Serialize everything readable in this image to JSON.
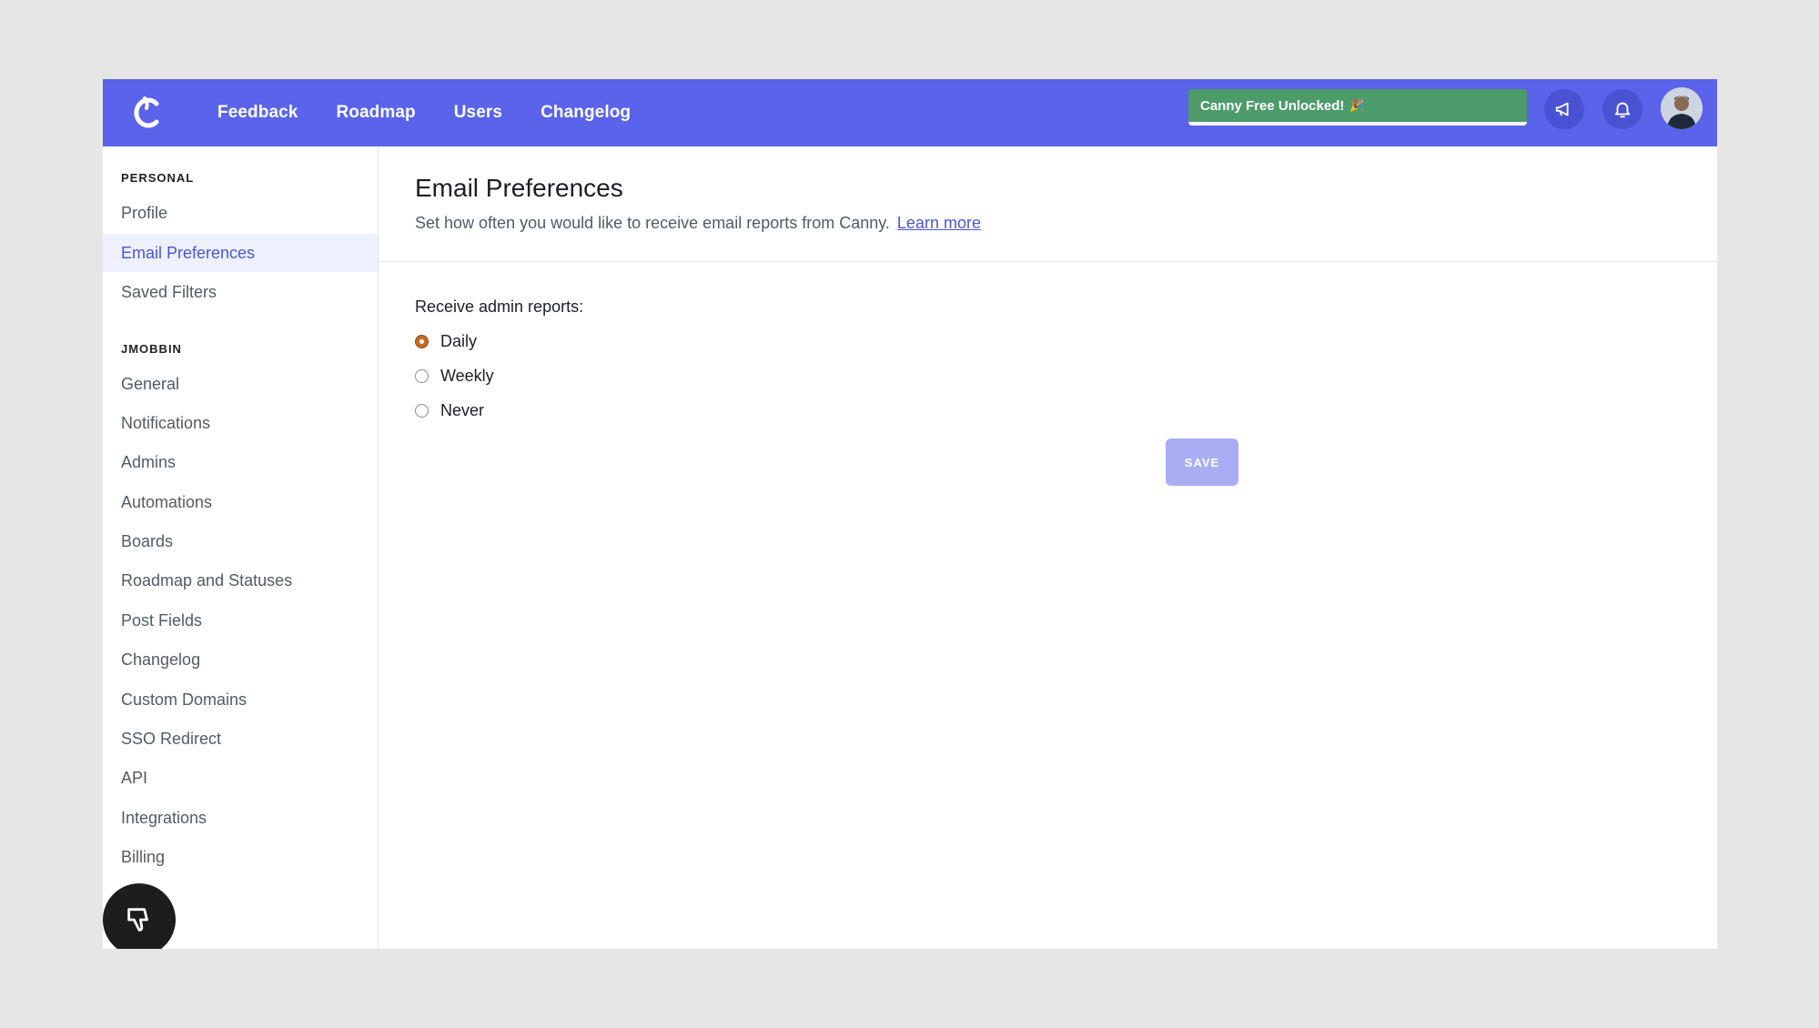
{
  "nav": {
    "links": [
      "Feedback",
      "Roadmap",
      "Users",
      "Changelog"
    ],
    "banner": "Canny Free Unlocked!",
    "banner_emoji": "🎉"
  },
  "sidebar": {
    "personal_heading": "PERSONAL",
    "personal_items": [
      "Profile",
      "Email Preferences",
      "Saved Filters"
    ],
    "active_item": "Email Preferences",
    "org_heading": "JMOBBIN",
    "org_items": [
      "General",
      "Notifications",
      "Admins",
      "Automations",
      "Boards",
      "Roadmap and Statuses",
      "Post Fields",
      "Changelog",
      "Custom Domains",
      "SSO Redirect",
      "API",
      "Integrations",
      "Billing"
    ]
  },
  "main": {
    "title": "Email Preferences",
    "subtitle": "Set how often you would like to receive email reports from Canny.",
    "learn_more": "Learn more",
    "field_label": "Receive admin reports:",
    "options": [
      "Daily",
      "Weekly",
      "Never"
    ],
    "selected": "Daily",
    "save_label": "SAVE"
  },
  "colors": {
    "brand": "#5a63ea",
    "banner": "#4d9b6a",
    "accent_text": "#4b55d6",
    "radio_checked": "#c96a24",
    "save_disabled": "#a8adf4"
  },
  "icons": [
    "canny-logo-icon",
    "megaphone-icon",
    "bell-icon",
    "avatar",
    "thumbs-down-icon"
  ]
}
